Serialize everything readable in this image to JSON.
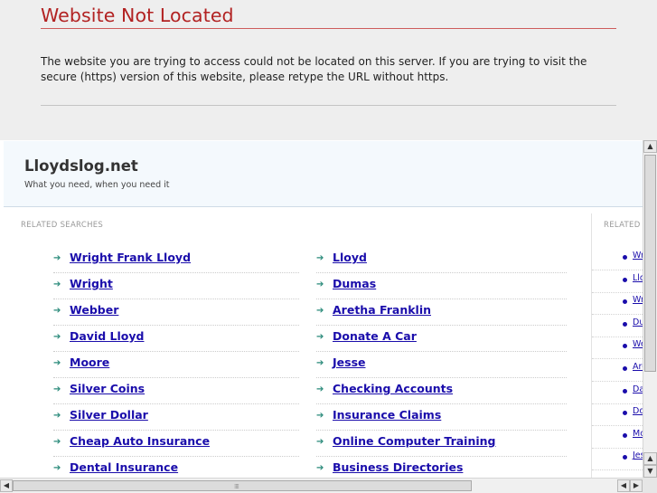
{
  "error": {
    "title": "Website Not Located",
    "message": "The website you are trying to access could not be located on this server. If you are trying to visit the secure (https) version of this website, please retype the URL without https."
  },
  "site": {
    "name": "Lloydslog.net",
    "tagline": "What you need, when you need it"
  },
  "related": {
    "label": "RELATED SEARCHES",
    "label_right": "RELATED",
    "left_column": [
      "Wright Frank Lloyd",
      "Wright",
      "Webber",
      "David Lloyd",
      "Moore",
      "Silver Coins",
      "Silver Dollar",
      "Cheap Auto Insurance",
      "Dental Insurance"
    ],
    "right_column": [
      "Lloyd",
      "Dumas",
      "Aretha Franklin",
      "Donate A Car",
      "Jesse",
      "Checking Accounts",
      "Insurance Claims",
      "Online Computer Training",
      "Business Directories"
    ],
    "side_items": [
      "Wri",
      "Llo",
      "Wri",
      "Du",
      "We",
      "Are",
      "Da",
      "Do",
      "Mc",
      "Jes"
    ]
  },
  "icons": {
    "arrow": "right-arrow-icon",
    "bullet": "bullet-icon"
  },
  "colors": {
    "error_title": "#b22222",
    "link": "#1a0dab",
    "arrow": "#2a8a7a"
  }
}
